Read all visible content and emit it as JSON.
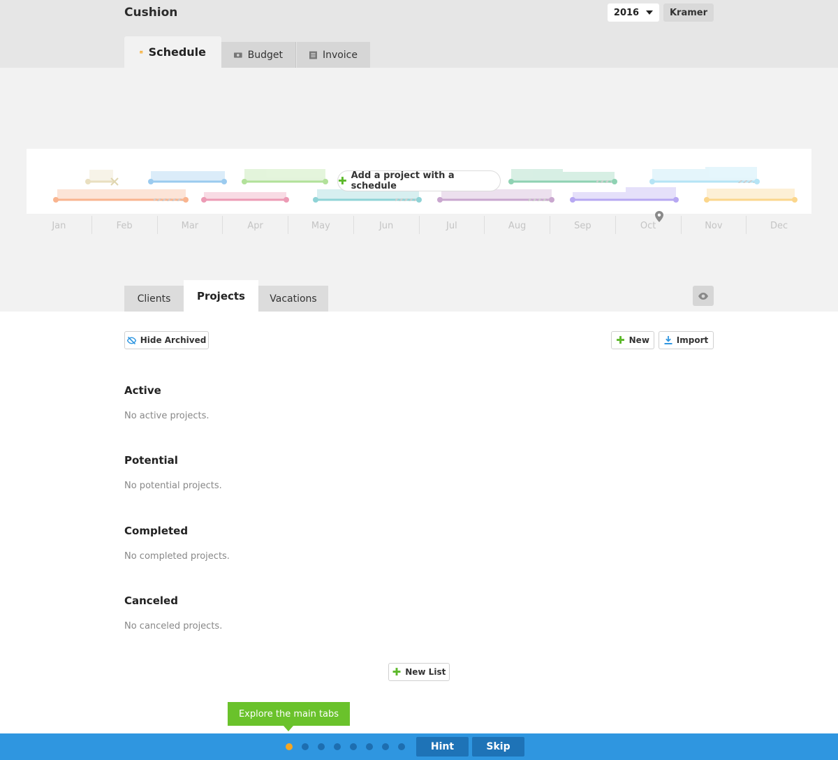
{
  "app": {
    "title": "Cushion"
  },
  "header": {
    "year": "2016",
    "user": "Kramer"
  },
  "main_tabs": [
    {
      "label": "Schedule",
      "icon": "calendar-icon"
    },
    {
      "label": "Budget",
      "icon": "money-icon"
    },
    {
      "label": "Invoice",
      "icon": "invoice-icon"
    }
  ],
  "timeline": {
    "add_label": "Add a project with a schedule",
    "months": [
      "Jan",
      "Feb",
      "Mar",
      "Apr",
      "May",
      "Jun",
      "Jul",
      "Aug",
      "Sep",
      "Oct",
      "Nov",
      "Dec"
    ],
    "colors": {
      "orange": "#f9b48f",
      "pink": "#ec9bb5",
      "teal": "#8fd3d6",
      "purple": "#c9a7cf",
      "violet": "#b7a8f2",
      "yellow": "#fbd68c",
      "blue": "#9bcbef",
      "green": "#b2e19a",
      "mint": "#8fd2b3",
      "cyan": "#b5e4f5",
      "beige": "#e9dfc0"
    }
  },
  "sub_tabs": [
    {
      "label": "Clients"
    },
    {
      "label": "Projects"
    },
    {
      "label": "Vacations"
    }
  ],
  "toolbar": {
    "hide_archived": "Hide Archived",
    "new": "New",
    "import": "Import"
  },
  "sections": [
    {
      "title": "Active",
      "empty": "No active projects."
    },
    {
      "title": "Potential",
      "empty": "No potential projects."
    },
    {
      "title": "Completed",
      "empty": "No completed projects."
    },
    {
      "title": "Canceled",
      "empty": "No canceled projects."
    }
  ],
  "new_list": "New List",
  "tour": {
    "tooltip": "Explore the main tabs",
    "hint": "Hint",
    "skip": "Skip",
    "total_steps": 8,
    "current_step": 1
  }
}
